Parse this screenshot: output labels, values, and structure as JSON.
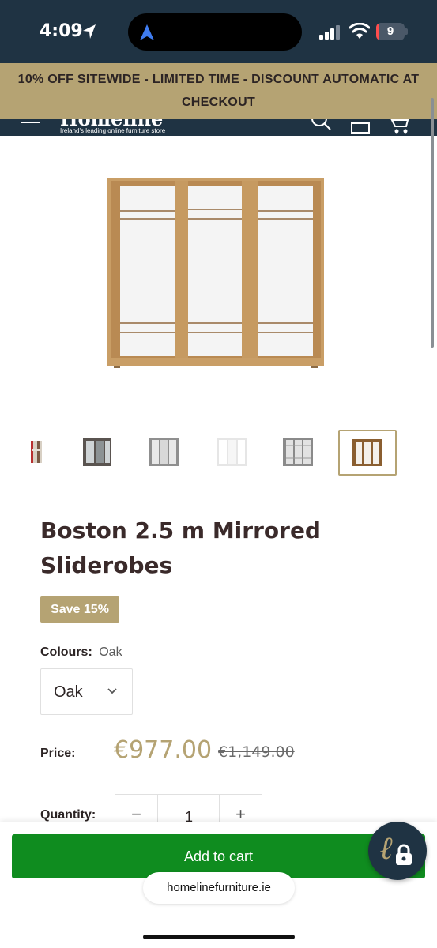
{
  "status_bar": {
    "time": "4:09",
    "battery_level": "9",
    "battery_fraction": 0.09,
    "icons": [
      "location-arrow-icon",
      "navigation-arrow-icon",
      "cellular-signal-icon",
      "wifi-icon",
      "battery-icon"
    ]
  },
  "promo": {
    "line1": "10% OFF SITEWIDE - LIMITED TIME - DISCOUNT AUTOMATIC AT",
    "line2": "CHECKOUT"
  },
  "header": {
    "logo": "Homeline",
    "tagline": "Ireland's leading online furniture store",
    "icons": [
      "menu-icon",
      "search-icon",
      "account-icon",
      "cart-icon"
    ]
  },
  "product": {
    "title": "Boston 2.5 m Mirrored Sliderobes",
    "badge": "Save 15%",
    "colours_label": "Colours:",
    "colours_value": "Oak",
    "selected_option": "Oak",
    "price_label": "Price:",
    "price": "€977.00",
    "old_price": "€1,149.00",
    "quantity_label": "Quantity:",
    "quantity": "1",
    "minus": "−",
    "plus": "+"
  },
  "thumbnails": [
    {
      "name": "dressing-room"
    },
    {
      "name": "dark-room-wardrobe"
    },
    {
      "name": "grey-wardrobe"
    },
    {
      "name": "white-wardrobe"
    },
    {
      "name": "grey-mirror-wardrobe"
    },
    {
      "name": "oak-wardrobe",
      "active": true
    }
  ],
  "actions": {
    "add_to_cart": "Add to cart"
  },
  "browser": {
    "url": "homelinefurniture.ie"
  },
  "colors": {
    "navy": "#1f3343",
    "gold": "#b5a373",
    "green": "#0f8c1f"
  }
}
